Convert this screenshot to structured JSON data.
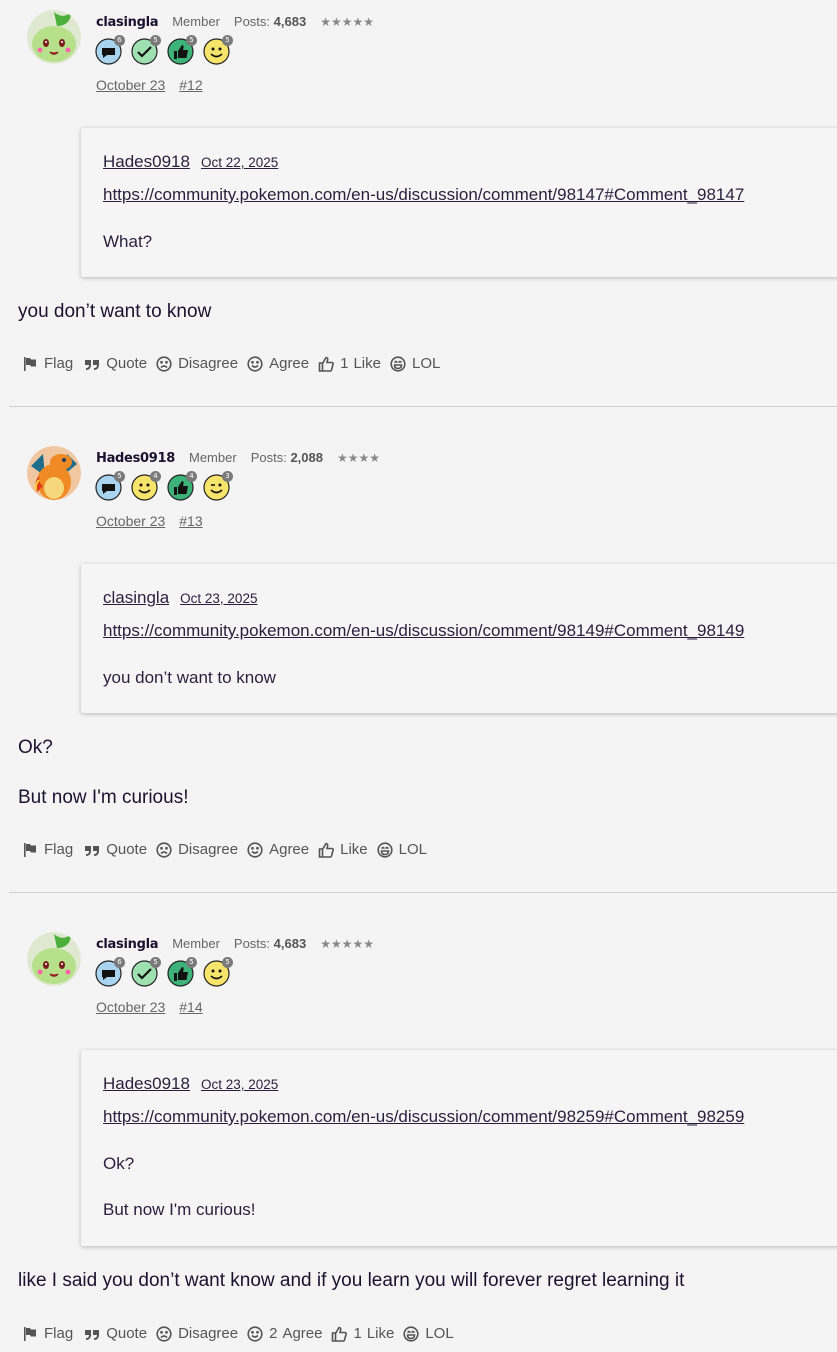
{
  "posts": [
    {
      "author": "clasingla",
      "role": "Member",
      "posts_label": "Posts:",
      "posts_count": "4,683",
      "stars": "★★★★★",
      "avatar_icon": "chikorita-avatar",
      "badges": [
        {
          "icon": "comment-badge-icon",
          "level": "6"
        },
        {
          "icon": "check-badge-icon",
          "level": "5"
        },
        {
          "icon": "thumb-badge-icon",
          "level": "5"
        },
        {
          "icon": "smile-badge-icon",
          "level": "5"
        }
      ],
      "date": "October 23",
      "permalink": "#12",
      "quote": {
        "author": "Hades0918",
        "date": "Oct 22, 2025",
        "link": "https://community.pokemon.com/en-us/discussion/comment/98147#Comment_98147",
        "lines": [
          "What?"
        ]
      },
      "body": [
        "you don’t want to know"
      ],
      "actions": {
        "flag": "Flag",
        "quote": "Quote",
        "disagree": "Disagree",
        "agree": "Agree",
        "agree_count": "",
        "like": "Like",
        "like_count": "1",
        "lol": "LOL"
      }
    },
    {
      "author": "Hades0918",
      "role": "Member",
      "posts_label": "Posts:",
      "posts_count": "2,088",
      "stars": "★★★★",
      "avatar_icon": "charizard-avatar",
      "badges": [
        {
          "icon": "comment-badge-icon",
          "level": "5"
        },
        {
          "icon": "smile-badge-icon",
          "level": "4"
        },
        {
          "icon": "thumb-badge-icon",
          "level": "4"
        },
        {
          "icon": "wink-badge-icon",
          "level": "3"
        }
      ],
      "date": "October 23",
      "permalink": "#13",
      "quote": {
        "author": "clasingla",
        "date": "Oct 23, 2025",
        "link": "https://community.pokemon.com/en-us/discussion/comment/98149#Comment_98149",
        "lines": [
          "you don’t want to know"
        ]
      },
      "body": [
        "Ok?",
        "But now I'm curious!"
      ],
      "actions": {
        "flag": "Flag",
        "quote": "Quote",
        "disagree": "Disagree",
        "agree": "Agree",
        "agree_count": "",
        "like": "Like",
        "like_count": "",
        "lol": "LOL"
      }
    },
    {
      "author": "clasingla",
      "role": "Member",
      "posts_label": "Posts:",
      "posts_count": "4,683",
      "stars": "★★★★★",
      "avatar_icon": "chikorita-avatar",
      "badges": [
        {
          "icon": "comment-badge-icon",
          "level": "6"
        },
        {
          "icon": "check-badge-icon",
          "level": "5"
        },
        {
          "icon": "thumb-badge-icon",
          "level": "5"
        },
        {
          "icon": "smile-badge-icon",
          "level": "5"
        }
      ],
      "date": "October 23",
      "permalink": "#14",
      "quote": {
        "author": "Hades0918",
        "date": "Oct 23, 2025",
        "link": "https://community.pokemon.com/en-us/discussion/comment/98259#Comment_98259",
        "lines": [
          "Ok?",
          "But now I'm curious!"
        ]
      },
      "body": [
        "like I said you don’t want know and if you learn you will forever regret learning it"
      ],
      "actions": {
        "flag": "Flag",
        "quote": "Quote",
        "disagree": "Disagree",
        "agree": "Agree",
        "agree_count": "2",
        "like": "Like",
        "like_count": "1",
        "lol": "LOL"
      }
    }
  ]
}
